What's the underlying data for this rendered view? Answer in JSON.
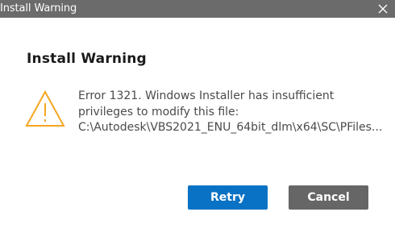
{
  "window": {
    "title": "Install Warning",
    "close_icon": "close-icon"
  },
  "dialog": {
    "heading": "Install Warning",
    "icon": "warning-icon",
    "message_lines": [
      "Error 1321. Windows Installer has insufficient",
      "privileges to modify this file:",
      "C:\\Autodesk\\VBS2021_ENU_64bit_dlm\\x64\\SC\\PFiles..."
    ]
  },
  "buttons": {
    "retry": "Retry",
    "cancel": "Cancel"
  },
  "colors": {
    "titlebar": "#6b6b6b",
    "warning": "#f5a623",
    "primary": "#0a72c4",
    "secondary": "#666666"
  }
}
